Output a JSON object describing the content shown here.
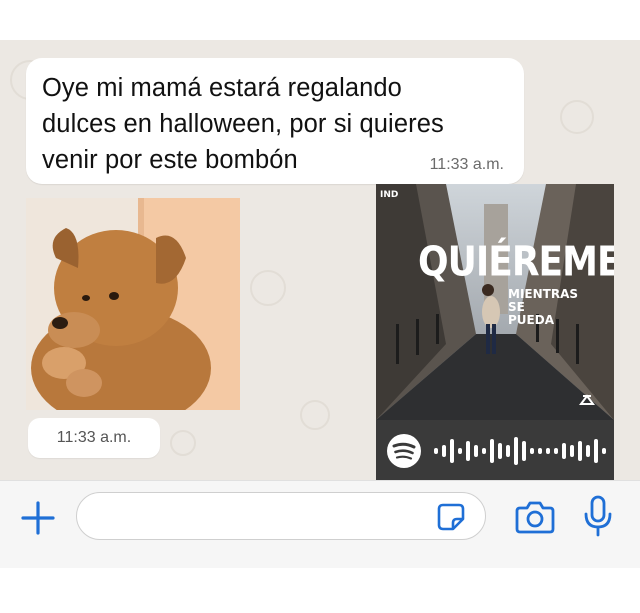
{
  "message": {
    "text_line1": "Oye mi mamá estará regalando",
    "text_line2": "dulces en halloween, por si quieres",
    "text_line3": "venir por este bombón",
    "time": "11:33 a.m."
  },
  "sticker": {
    "time": "11:33 a.m."
  },
  "spotify_card": {
    "cover_logo": "IND",
    "cover_title": "QUIÉREME",
    "cover_subtitle_line1": "MIENTRAS",
    "cover_subtitle_line2": "SE PUEDA",
    "brand_color": "#1db954"
  },
  "input_bar": {
    "placeholder": "",
    "accent_color": "#1f6fd6",
    "icons": [
      "plus-icon",
      "sticker-icon",
      "camera-icon",
      "microphone-icon"
    ]
  }
}
